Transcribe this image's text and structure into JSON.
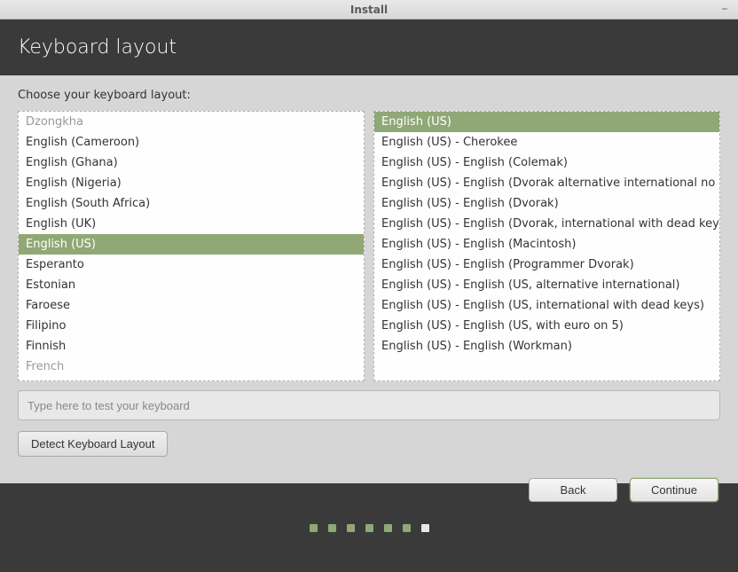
{
  "window": {
    "title": "Install"
  },
  "header": {
    "title": "Keyboard layout"
  },
  "main": {
    "prompt": "Choose your keyboard layout:",
    "layouts": [
      {
        "label": "Dzongkha",
        "partial": true
      },
      {
        "label": "English (Cameroon)"
      },
      {
        "label": "English (Ghana)"
      },
      {
        "label": "English (Nigeria)"
      },
      {
        "label": "English (South Africa)"
      },
      {
        "label": "English (UK)"
      },
      {
        "label": "English (US)",
        "selected": true
      },
      {
        "label": "Esperanto"
      },
      {
        "label": "Estonian"
      },
      {
        "label": "Faroese"
      },
      {
        "label": "Filipino"
      },
      {
        "label": "Finnish"
      },
      {
        "label": "French",
        "partial": true
      }
    ],
    "variants": [
      {
        "label": "English (US)",
        "selected": true
      },
      {
        "label": "English (US) - Cherokee"
      },
      {
        "label": "English (US) - English (Colemak)"
      },
      {
        "label": "English (US) - English (Dvorak alternative international no dead keys)"
      },
      {
        "label": "English (US) - English (Dvorak)"
      },
      {
        "label": "English (US) - English (Dvorak, international with dead keys)"
      },
      {
        "label": "English (US) - English (Macintosh)"
      },
      {
        "label": "English (US) - English (Programmer Dvorak)"
      },
      {
        "label": "English (US) - English (US, alternative international)"
      },
      {
        "label": "English (US) - English (US, international with dead keys)"
      },
      {
        "label": "English (US) - English (US, with euro on 5)"
      },
      {
        "label": "English (US) - English (Workman)"
      }
    ],
    "test_placeholder": "Type here to test your keyboard",
    "detect_label": "Detect Keyboard Layout",
    "back_label": "Back",
    "continue_label": "Continue"
  },
  "progress": {
    "dots": [
      "done",
      "done",
      "done",
      "done",
      "done",
      "done",
      "current"
    ]
  }
}
